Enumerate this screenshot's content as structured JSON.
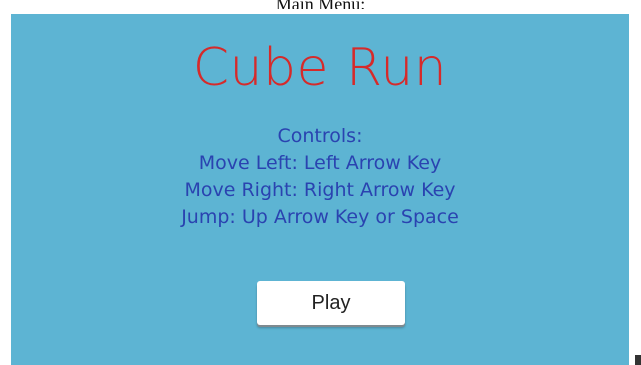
{
  "caption": "Main Menu:",
  "game": {
    "title": "Cube Run",
    "controls": {
      "heading": "Controls:",
      "lines": [
        "Move Left: Left Arrow Key",
        "Move Right: Right Arrow Key",
        "Jump: Up Arrow Key or Space"
      ]
    },
    "play_label": "Play"
  },
  "colors": {
    "background": "#5db4d3",
    "title": "#d62a2a",
    "controls_text": "#2a43b0",
    "button": "#ffffff"
  }
}
